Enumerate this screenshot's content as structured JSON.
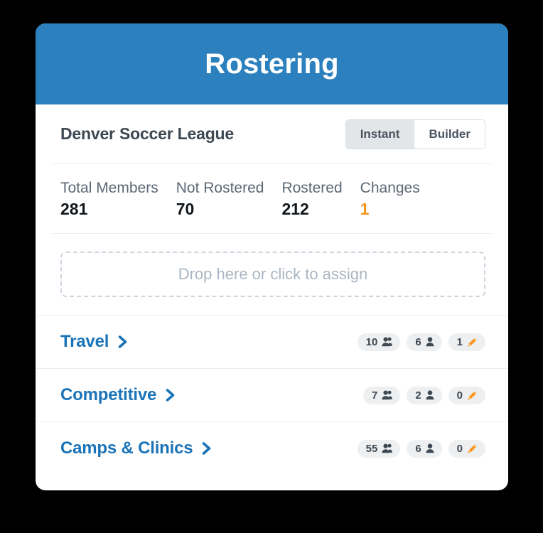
{
  "header": {
    "title": "Rostering",
    "background_color": "#2b80bd"
  },
  "league": {
    "name": "Denver Soccer League",
    "mode_toggle": {
      "options": [
        "Instant",
        "Builder"
      ],
      "selected": "Instant"
    }
  },
  "stats": [
    {
      "label": "Total Members",
      "value": "281",
      "accent": false
    },
    {
      "label": "Not Rostered",
      "value": "70",
      "accent": false
    },
    {
      "label": "Rostered",
      "value": "212",
      "accent": false
    },
    {
      "label": "Changes",
      "value": "1",
      "accent": true
    }
  ],
  "dropzone": {
    "text": "Drop here or click to assign"
  },
  "groups": [
    {
      "name": "Travel",
      "chevron_icon": "chevron-right-icon",
      "badges": [
        {
          "count": "10",
          "icon": "group-users-icon"
        },
        {
          "count": "6",
          "icon": "single-user-icon"
        },
        {
          "count": "1",
          "icon": "pencil-edit-icon"
        }
      ]
    },
    {
      "name": "Competitive",
      "chevron_icon": "chevron-right-icon",
      "badges": [
        {
          "count": "7",
          "icon": "group-users-icon"
        },
        {
          "count": "2",
          "icon": "single-user-icon"
        },
        {
          "count": "0",
          "icon": "pencil-edit-icon"
        }
      ]
    },
    {
      "name": "Camps & Clinics",
      "chevron_icon": "chevron-right-icon",
      "badges": [
        {
          "count": "55",
          "icon": "group-users-icon"
        },
        {
          "count": "6",
          "icon": "single-user-icon"
        },
        {
          "count": "0",
          "icon": "pencil-edit-icon"
        }
      ]
    }
  ],
  "colors": {
    "header_blue": "#2b80bd",
    "link_blue": "#1b74b8",
    "accent_orange": "#f7941e",
    "badge_bg": "#eeeff1",
    "text_dark": "#3d4852"
  }
}
